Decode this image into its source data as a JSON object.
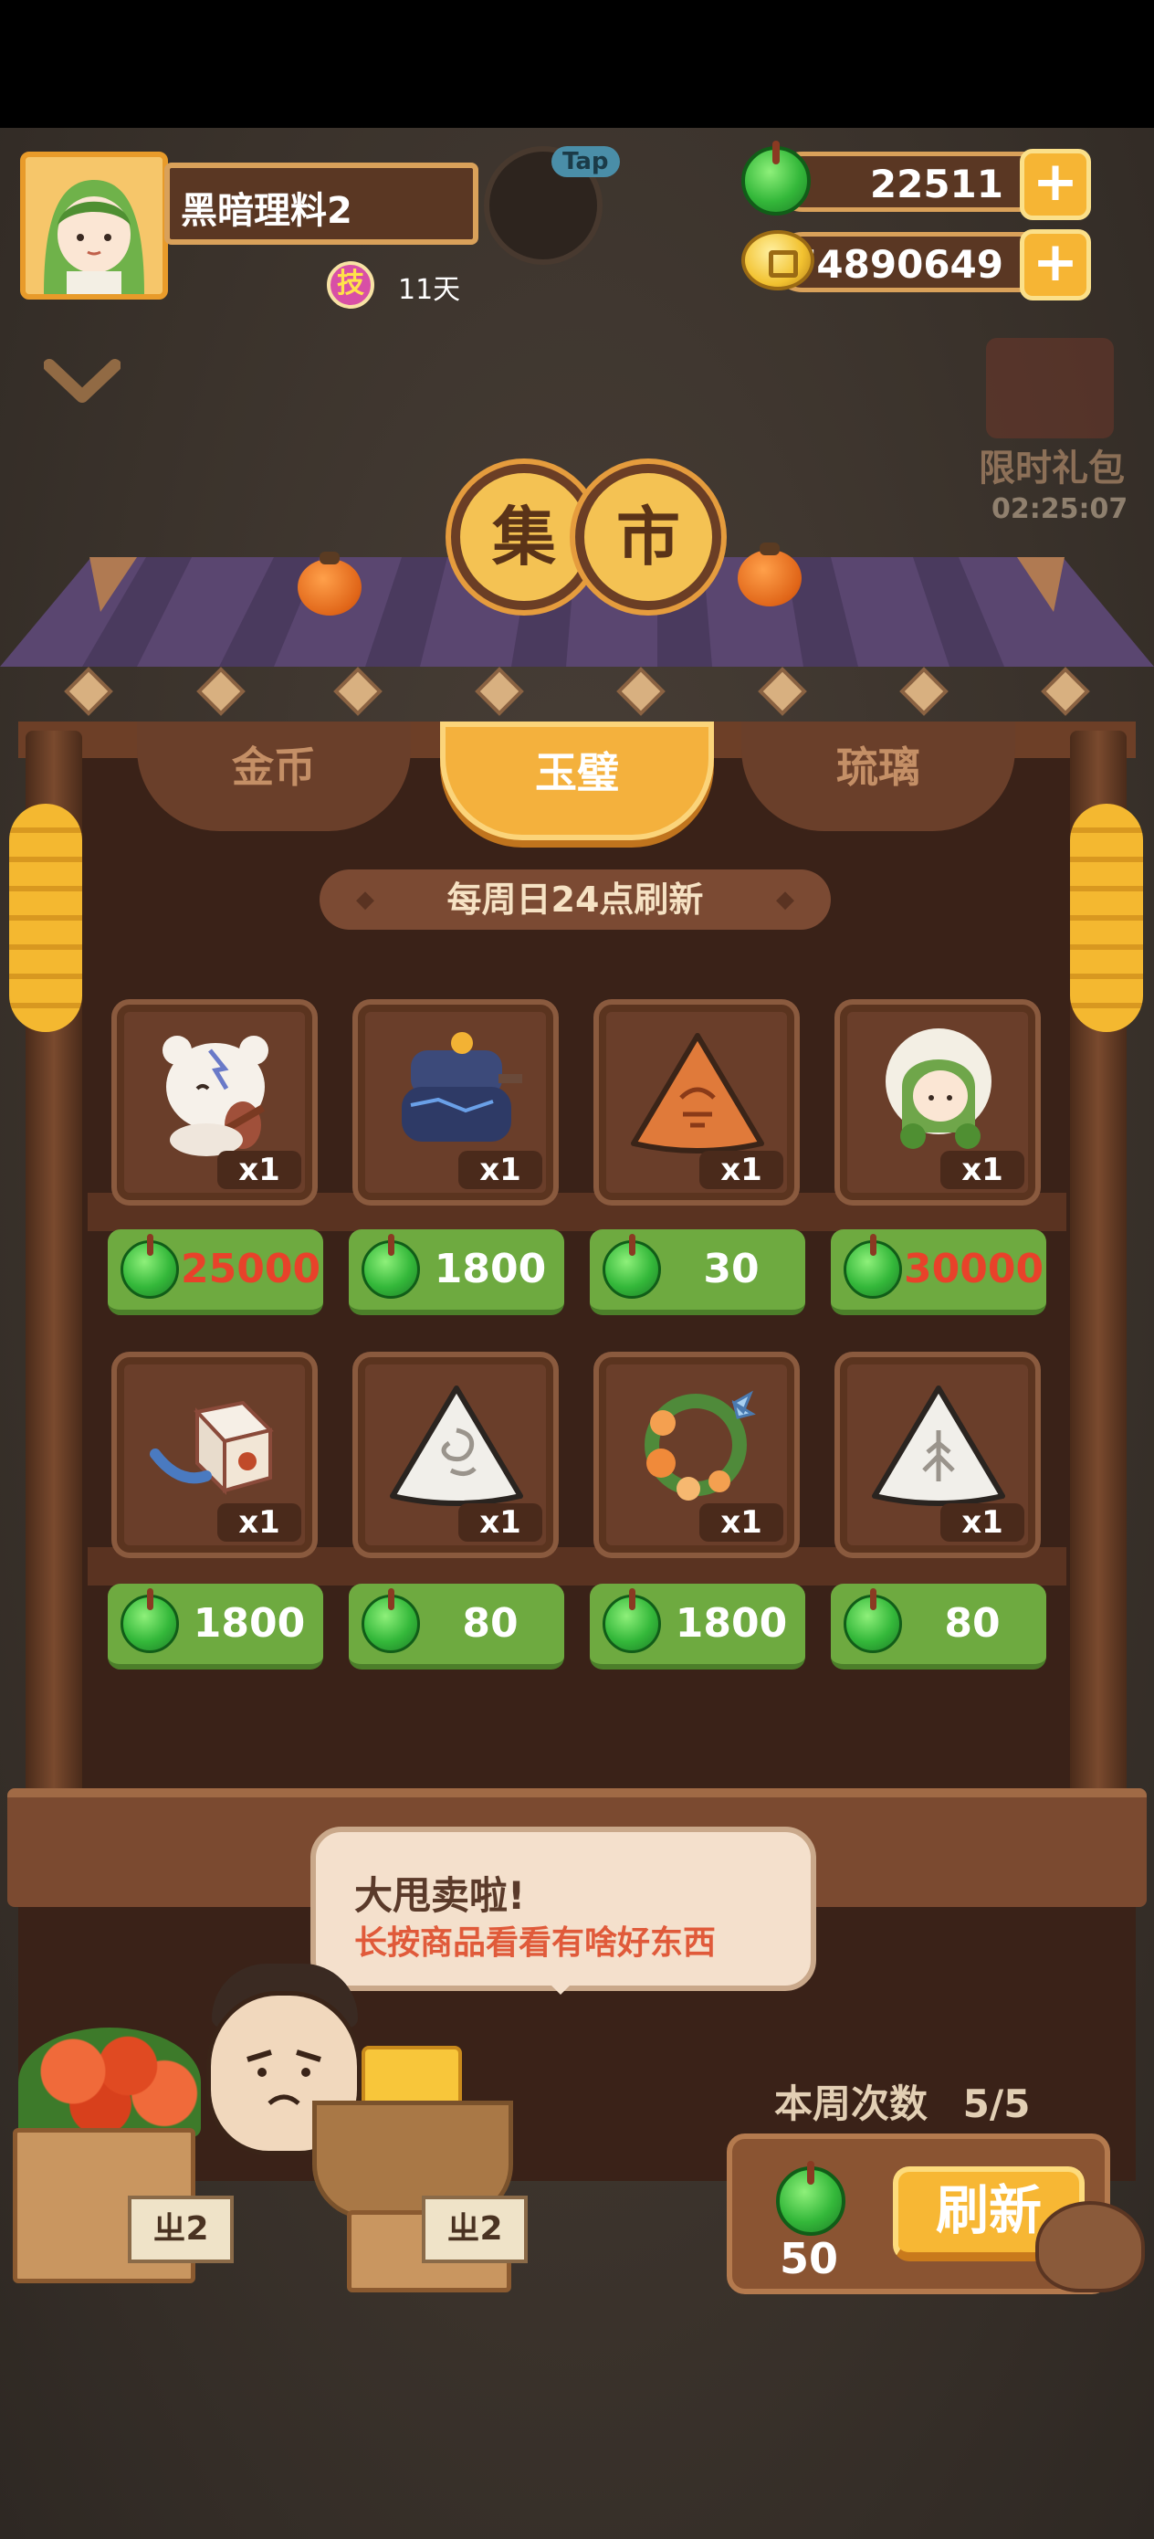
{
  "player": {
    "name": "黑暗理料2",
    "skill_icon": "技",
    "skill_days": "11天",
    "tap_label": "Tap"
  },
  "currency": {
    "jade": "22511",
    "gold": "74890649",
    "add_label": "+"
  },
  "gift": {
    "label": "限时礼包",
    "timer": "02:25:07"
  },
  "market": {
    "title_chars": [
      "集",
      "市"
    ]
  },
  "tabs": [
    {
      "label": "金币",
      "active": false
    },
    {
      "label": "玉璧",
      "active": true
    },
    {
      "label": "琉璃",
      "active": false
    }
  ],
  "refresh_note": "每周日24点刷新",
  "items": [
    {
      "name": "bear-lute-figure",
      "qty": "x1",
      "price": "25000",
      "price_color": "#e8422a"
    },
    {
      "name": "blue-stone-mill",
      "qty": "x1",
      "price": "1800",
      "price_color": "#ffffff"
    },
    {
      "name": "orange-rice-ball",
      "qty": "x1",
      "price": "30",
      "price_color": "#ffffff"
    },
    {
      "name": "green-hair-girl",
      "qty": "x1",
      "price": "30000",
      "price_color": "#e8422a"
    },
    {
      "name": "dice-toy",
      "qty": "x1",
      "price": "1800",
      "price_color": "#ffffff"
    },
    {
      "name": "white-rice-ball-swirl",
      "qty": "x1",
      "price": "80",
      "price_color": "#ffffff"
    },
    {
      "name": "flower-wreath",
      "qty": "x1",
      "price": "1800",
      "price_color": "#ffffff"
    },
    {
      "name": "white-rice-ball-leaf",
      "qty": "x1",
      "price": "80",
      "price_color": "#ffffff"
    }
  ],
  "speech": {
    "line1": "大甩卖啦!",
    "line2": "长按商品看看有啥好东西"
  },
  "week": {
    "label": "本周次数",
    "count": "5/5"
  },
  "refresh": {
    "cost": "50",
    "label": "刷新"
  },
  "price_tags": [
    "ㄓ2",
    "ㄓ2"
  ],
  "colors": {
    "accent": "#f4b13d",
    "price_green": "#6eaa40",
    "wood_dark": "#3a2218",
    "roof_purple": "#5a4670"
  }
}
